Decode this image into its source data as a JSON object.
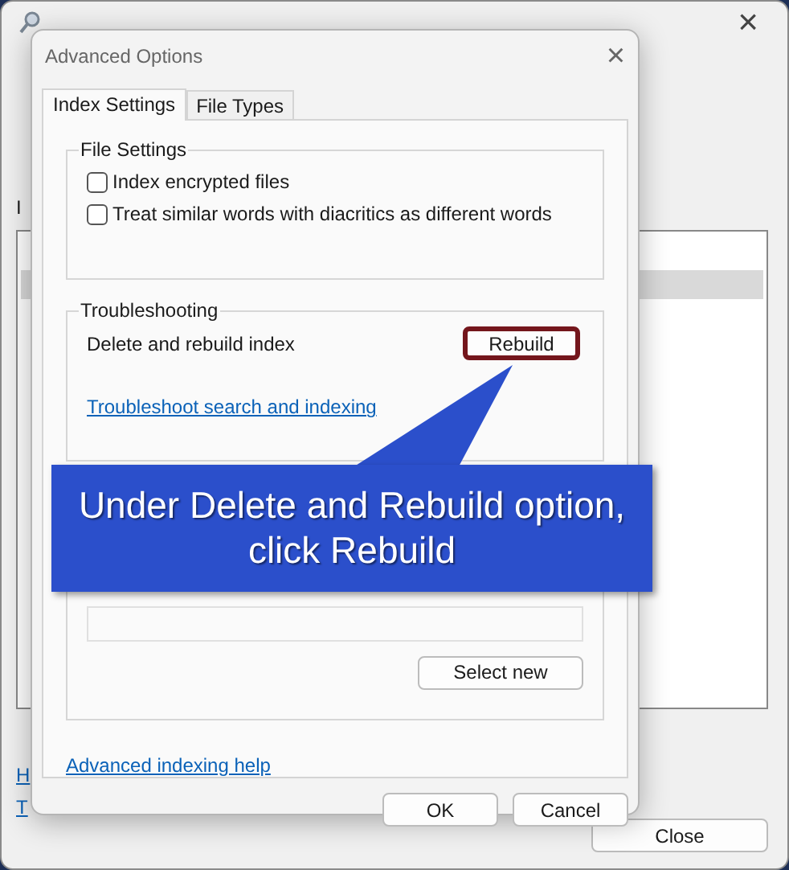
{
  "background_window": {
    "label_fragment": "I",
    "links": [
      "H",
      "T"
    ],
    "close_button": "Close"
  },
  "dialog": {
    "title": "Advanced Options",
    "close": "×",
    "tabs": [
      {
        "label": "Index Settings",
        "selected": true
      },
      {
        "label": "File Types",
        "selected": false
      }
    ],
    "file_settings": {
      "title": "File Settings",
      "options": [
        {
          "label": "Index encrypted files",
          "checked": false
        },
        {
          "label": "Treat similar words with diacritics as different words",
          "checked": false
        }
      ]
    },
    "troubleshooting": {
      "title": "Troubleshooting",
      "label": "Delete and rebuild index",
      "button": "Rebuild",
      "highlighted": true,
      "link": "Troubleshoot search and indexing"
    },
    "index_location": {
      "button": "Select new"
    },
    "help_link": "Advanced indexing help",
    "buttons": [
      "OK",
      "Cancel"
    ]
  },
  "callout": {
    "text": "Under Delete and Rebuild option,\nclick Rebuild"
  }
}
